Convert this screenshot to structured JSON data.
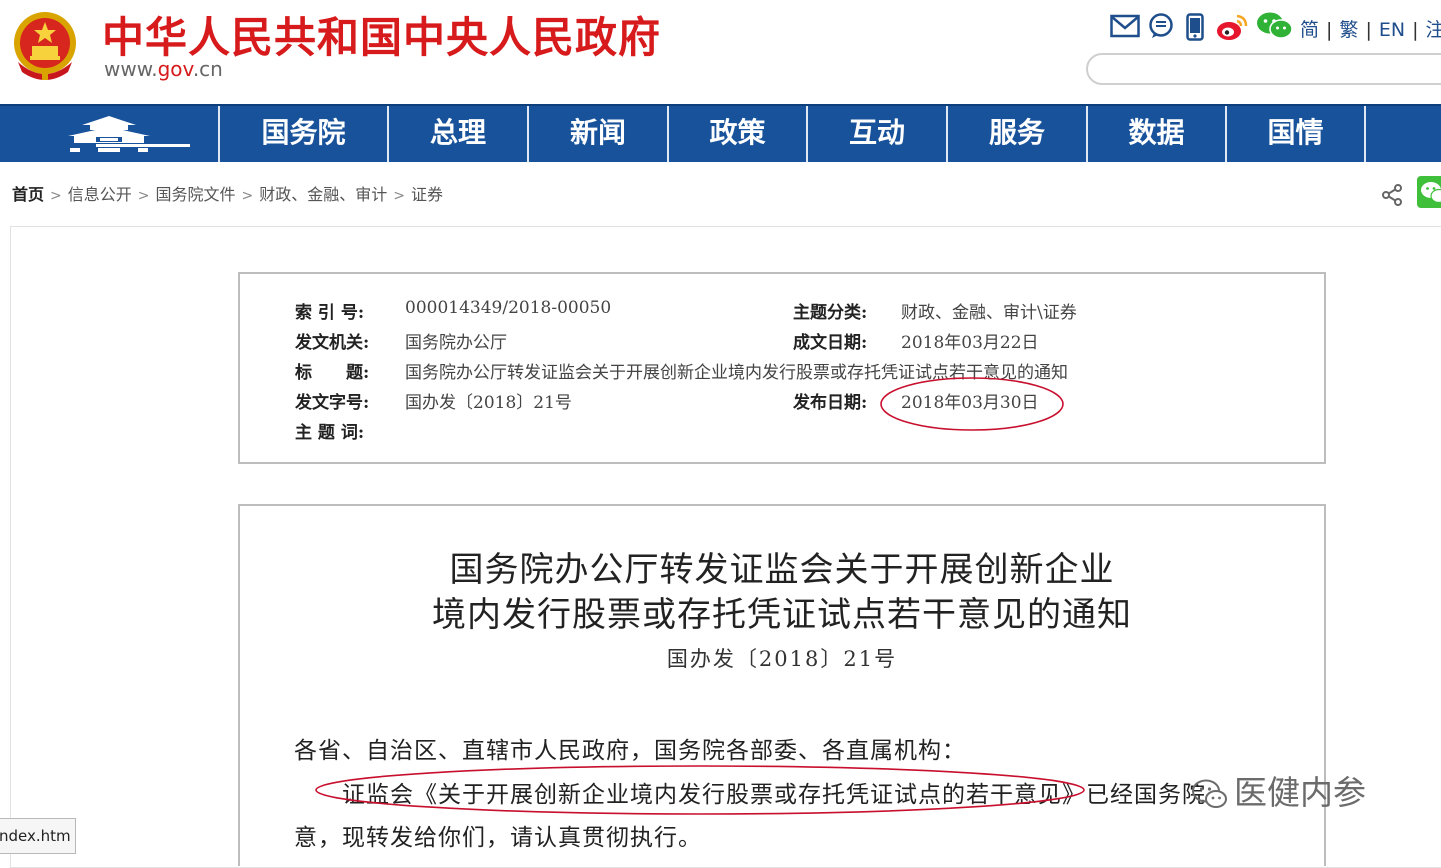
{
  "header": {
    "site_name": "中华人民共和国中央人民政府",
    "domain_prefix": "www.",
    "domain_brand": "gov",
    "domain_suffix": ".cn",
    "lang_links": [
      "简",
      "繁",
      "EN",
      "注"
    ],
    "icons": [
      "email-icon",
      "message-icon",
      "mobile-icon",
      "weibo-icon",
      "wechat-icon"
    ]
  },
  "nav": {
    "items": [
      "国务院",
      "总理",
      "新闻",
      "政策",
      "互动",
      "服务",
      "数据",
      "国情"
    ]
  },
  "breadcrumb": {
    "items": [
      "首页",
      "信息公开",
      "国务院文件",
      "财政、金融、审计",
      "证券"
    ]
  },
  "meta": {
    "index_label": "索 引 号:",
    "index_value": "000014349/2018-00050",
    "topic_label": "主题分类:",
    "topic_value": "财政、金融、审计\\证券",
    "issuer_label": "发文机关:",
    "issuer_value": "国务院办公厅",
    "written_label": "成文日期:",
    "written_value": "2018年03月22日",
    "title_label": "标　　题:",
    "title_value": "国务院办公厅转发证监会关于开展创新企业境内发行股票或存托凭证试点若干意见的通知",
    "docno_label": "发文字号:",
    "docno_value": "国办发〔2018〕21号",
    "published_label": "发布日期:",
    "published_value": "2018年03月30日",
    "keywords_label": "主 题 词:"
  },
  "document": {
    "title_line1": "国务院办公厅转发证监会关于开展创新企业",
    "title_line2": "境内发行股票或存托凭证试点若干意见的通知",
    "number": "国办发〔2018〕21号",
    "salutation": "各省、自治区、直辖市人民政府，国务院各部委、各直属机构：",
    "body_line1": "证监会《关于开展创新企业境内发行股票或存托凭证试点的若干意见》已经国务院",
    "body_line2": "意，现转发给你们，请认真贯彻执行。"
  },
  "watermark": "医健内参",
  "status_bar": "ndex.htm",
  "colors": {
    "brand_red": "#d71a1b",
    "nav_blue": "#17529b",
    "annotation_red": "#c8102e"
  }
}
